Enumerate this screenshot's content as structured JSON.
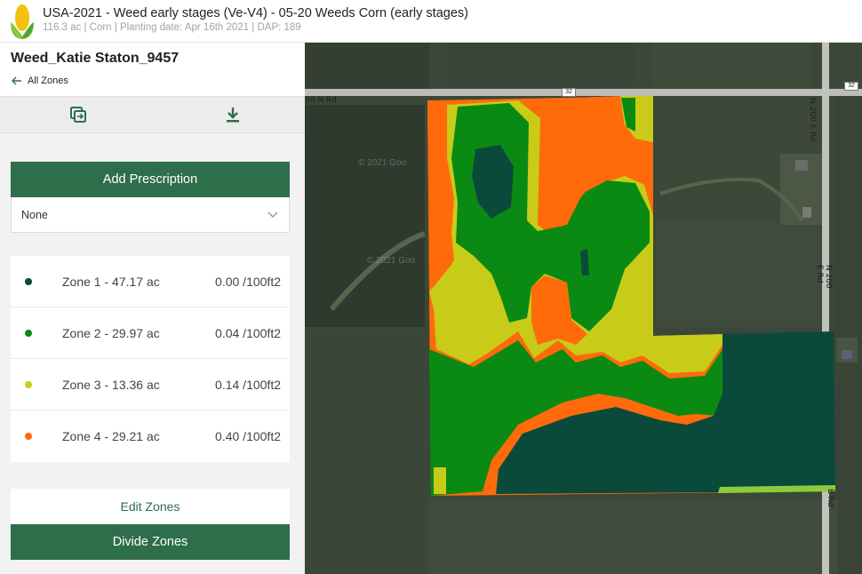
{
  "header": {
    "title": "USA-2021 - Weed early stages (Ve-V4) - 05-20 Weeds Corn (early stages)",
    "subtitle": "116.3 ac | Corn | Planting date: Apr 16th 2021 | DAP: 189",
    "logo_icon": "corn-logo-icon"
  },
  "sidebar": {
    "map_name": "Weed_Katie Staton_9457",
    "back_label": "All Zones",
    "toolbar": {
      "swap_icon": "swap-icon",
      "download_icon": "download-icon"
    },
    "add_prescription_label": "Add Prescription",
    "prescription_select_value": "None",
    "zones": [
      {
        "label": "Zone 1 - 47.17 ac",
        "rate": "0.00 /100ft2",
        "color": "#0a4a3a"
      },
      {
        "label": "Zone 2 - 29.97 ac",
        "rate": "0.04 /100ft2",
        "color": "#0a8a12"
      },
      {
        "label": "Zone 3 - 13.36 ac",
        "rate": "0.14 /100ft2",
        "color": "#c8cc18"
      },
      {
        "label": "Zone 4 - 29.21 ac",
        "rate": "0.40 /100ft2",
        "color": "#ff6a0a"
      }
    ],
    "edit_zones_label": "Edit Zones",
    "divide_zones_label": "Divide Zones"
  },
  "map": {
    "road_left_label": "00 N Rd",
    "road_right_label_top": "N 200 E Rd",
    "road_right_label_mid": "N 200 E Rd",
    "road_right_label_bottom": "E Rd",
    "shield_1": "32",
    "shield_2": "32",
    "watermark_1": "© 2021 Goo",
    "watermark_2": "© 2021 Goo"
  },
  "colors": {
    "brand_green": "#2e6e4a",
    "zone1": "#0a4a3a",
    "zone2": "#0a8a12",
    "zone3": "#c8cc18",
    "zone4": "#ff6a0a"
  }
}
